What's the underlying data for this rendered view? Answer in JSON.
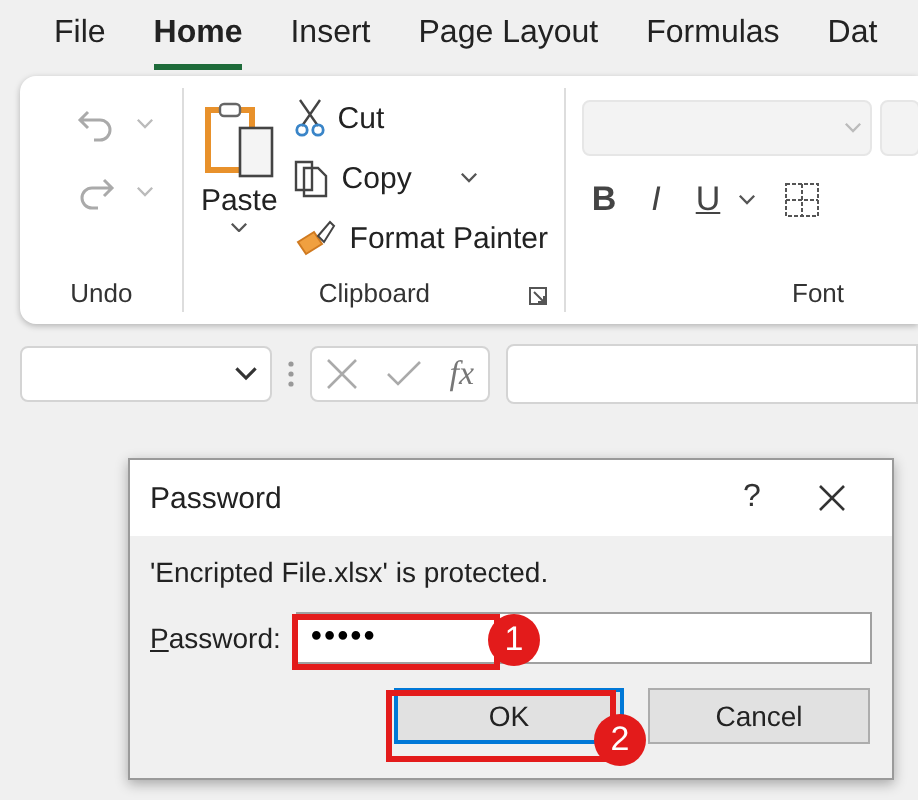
{
  "menu_tabs": [
    {
      "label": "File",
      "selected": false
    },
    {
      "label": "Home",
      "selected": true
    },
    {
      "label": "Insert",
      "selected": false
    },
    {
      "label": "Page Layout",
      "selected": false
    },
    {
      "label": "Formulas",
      "selected": false
    },
    {
      "label": "Dat",
      "selected": false
    }
  ],
  "ribbon": {
    "undo_group": {
      "label": "Undo"
    },
    "clipboard_group": {
      "label": "Clipboard",
      "paste": "Paste",
      "cut": "Cut",
      "copy": "Copy",
      "format_painter": "Format Painter"
    },
    "font_group": {
      "label": "Font",
      "bold": "B",
      "italic": "I",
      "underline": "U"
    }
  },
  "formula_bar": {
    "function_symbol": "fx"
  },
  "dialog": {
    "title": "Password",
    "help": "?",
    "message": "'Encripted File.xlsx' is protected.",
    "field_label": "Password:",
    "field_value": "•••••",
    "buttons": [
      {
        "label": "OK",
        "default": true
      },
      {
        "label": "Cancel",
        "default": false
      }
    ]
  },
  "callouts": [
    {
      "number": "1",
      "kind": "field"
    },
    {
      "number": "2",
      "kind": "button"
    }
  ]
}
